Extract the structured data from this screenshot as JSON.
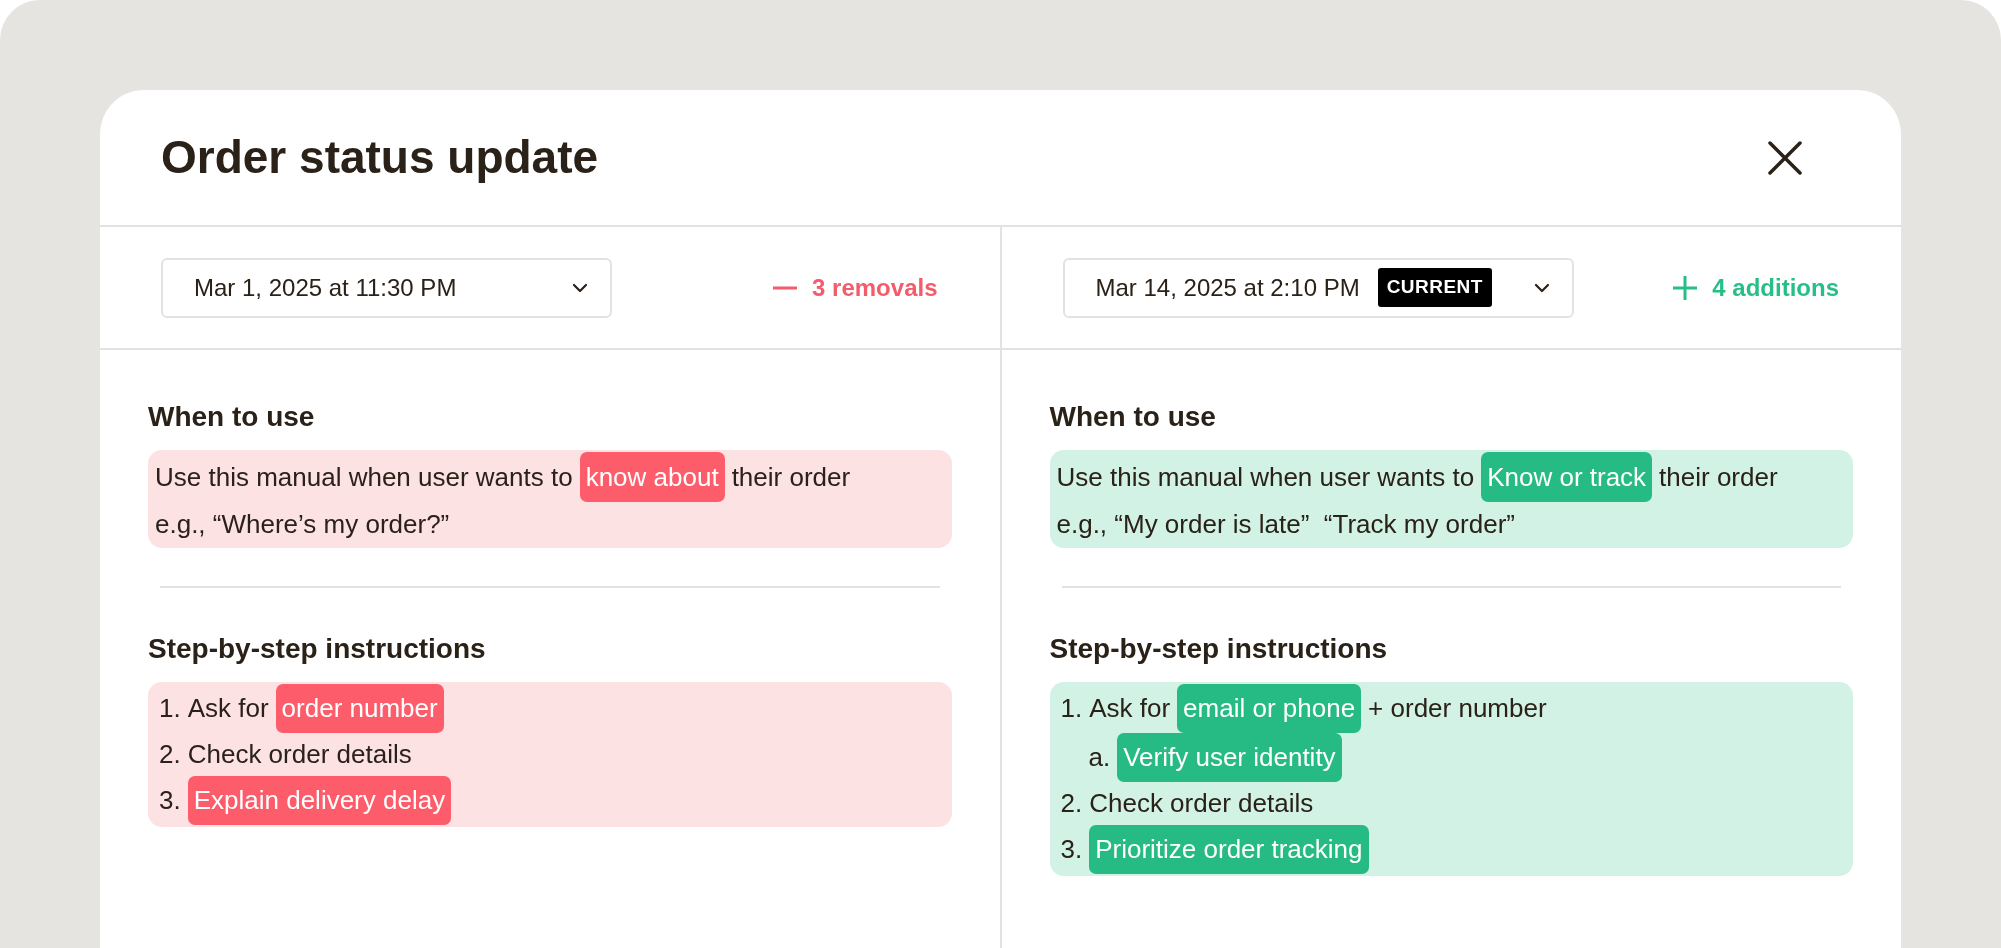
{
  "dialog": {
    "title": "Order status update"
  },
  "panes": [
    {
      "version": {
        "date": "Mar 1, 2025 at 11:30 PM"
      },
      "change": {
        "kind": "removal",
        "label": "3 removals"
      },
      "sections": [
        {
          "heading": "When to use",
          "kind": "paragraph",
          "lines": [
            [
              {
                "text": "Use this manual when user wants to",
                "highlighted": false
              },
              {
                "text": "know about",
                "highlighted": true
              },
              {
                "text": "their order",
                "highlighted": false
              }
            ],
            [
              {
                "text": "e.g., “Where’s my order?”",
                "highlighted": false
              }
            ]
          ]
        },
        {
          "heading": "Step-by-step instructions",
          "kind": "list",
          "items": [
            {
              "marker": "1.",
              "segments": [
                {
                  "text": "Ask for",
                  "highlighted": false
                },
                {
                  "text": "order number",
                  "highlighted": true
                }
              ]
            },
            {
              "marker": "2.",
              "segments": [
                {
                  "text": "Check order details",
                  "highlighted": false
                }
              ]
            },
            {
              "marker": "3.",
              "segments": [
                {
                  "text": "Explain delivery delay",
                  "highlighted": true
                }
              ]
            }
          ]
        }
      ]
    },
    {
      "version": {
        "date": "Mar 14, 2025 at 2:10 PM",
        "badge": "CURRENT"
      },
      "change": {
        "kind": "addition",
        "label": "4 additions"
      },
      "sections": [
        {
          "heading": "When to use",
          "kind": "paragraph",
          "lines": [
            [
              {
                "text": "Use this manual when user wants to",
                "highlighted": false
              },
              {
                "text": "Know or track",
                "highlighted": true
              },
              {
                "text": "their order",
                "highlighted": false
              }
            ],
            [
              {
                "text": "e.g., “My order is late”  “Track my order”",
                "highlighted": false
              }
            ]
          ]
        },
        {
          "heading": "Step-by-step instructions",
          "kind": "list",
          "items": [
            {
              "marker": "1.",
              "segments": [
                {
                  "text": "Ask for",
                  "highlighted": false
                },
                {
                  "text": "email or phone",
                  "highlighted": true
                },
                {
                  "text": "+ order number",
                  "highlighted": false
                }
              ],
              "children": [
                {
                  "marker": "a.",
                  "segments": [
                    {
                      "text": "Verify user identity",
                      "highlighted": true
                    }
                  ]
                }
              ]
            },
            {
              "marker": "2.",
              "segments": [
                {
                  "text": "Check order details",
                  "highlighted": false
                }
              ]
            },
            {
              "marker": "3.",
              "segments": [
                {
                  "text": "Prioritize order tracking",
                  "highlighted": true
                }
              ]
            }
          ]
        }
      ]
    }
  ]
}
